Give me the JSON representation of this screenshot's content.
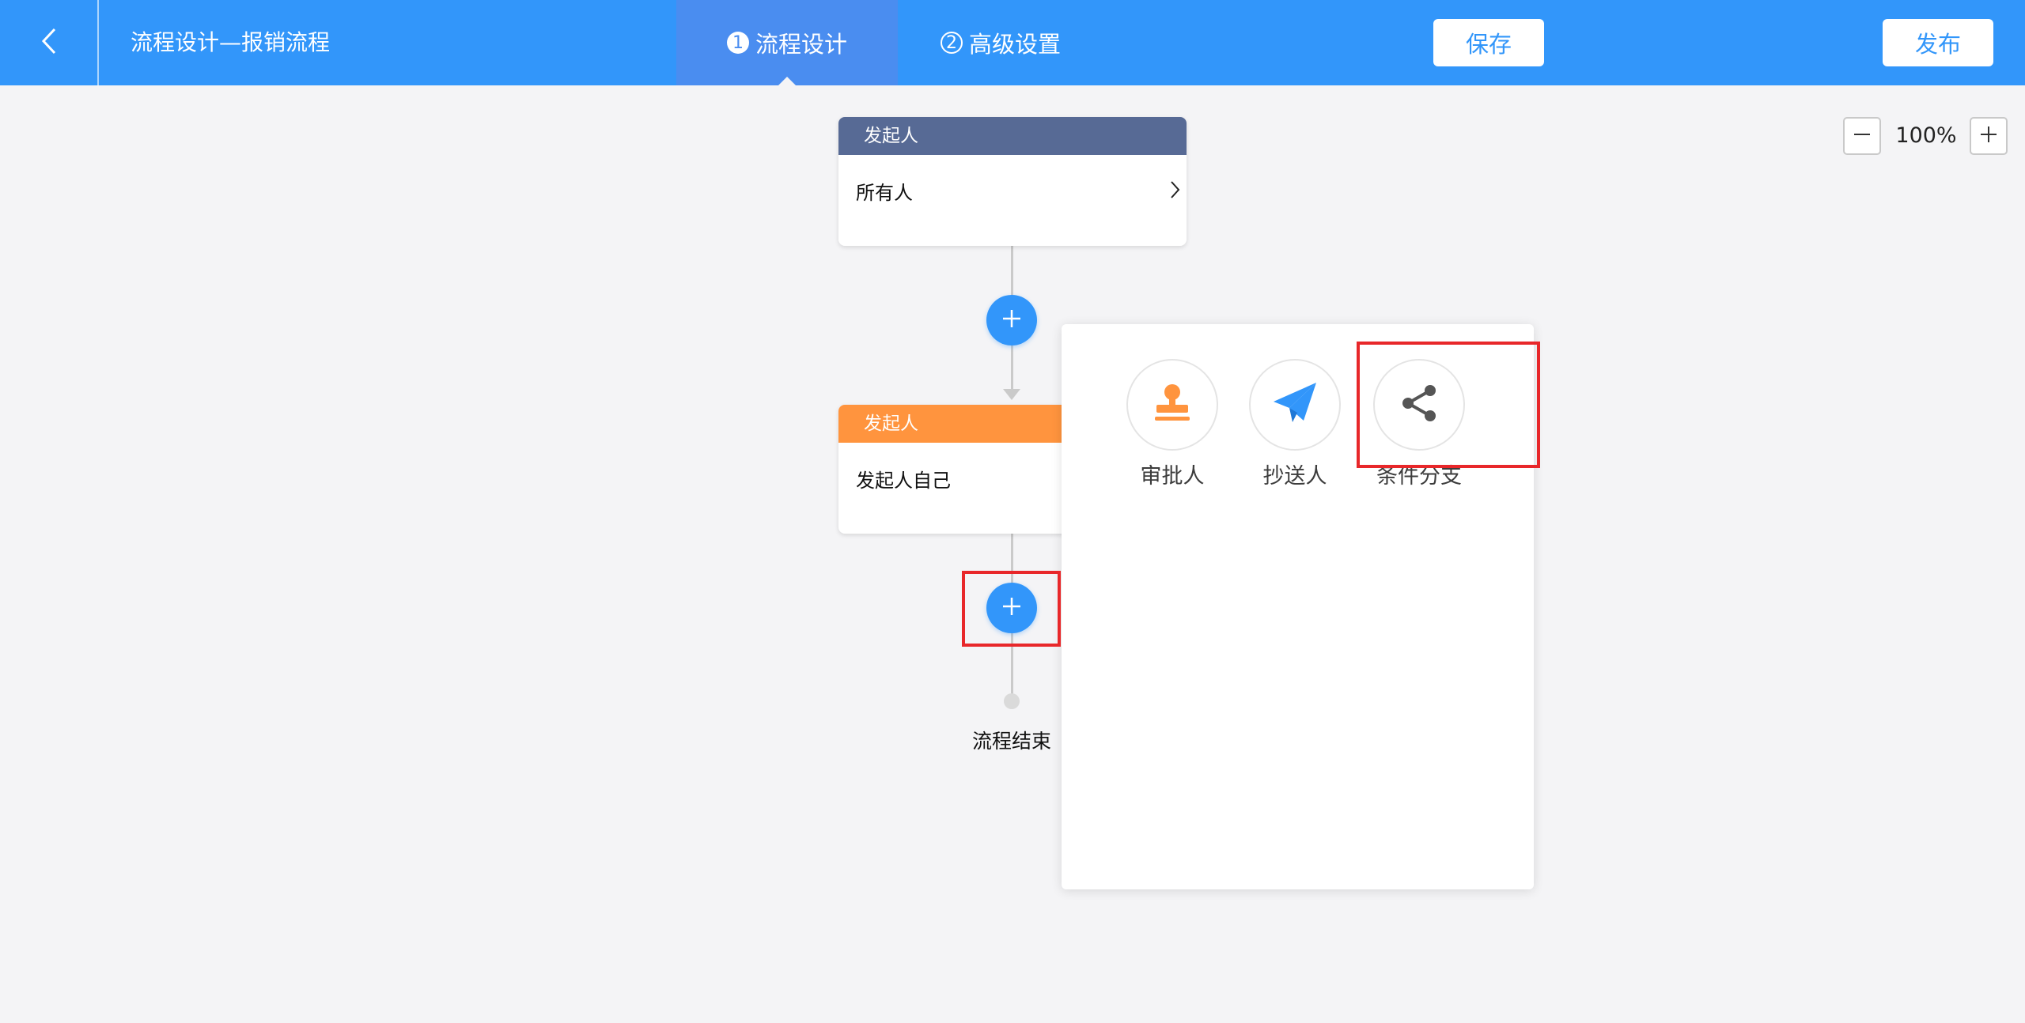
{
  "header": {
    "back_icon": "chevron-left-icon",
    "title": "流程设计—报销流程",
    "tabs": [
      {
        "number": "1",
        "label": "流程设计",
        "active": true
      },
      {
        "number": "2",
        "label": "高级设置",
        "active": false
      }
    ],
    "save_label": "保存",
    "publish_label": "发布",
    "background": "#3296fa"
  },
  "zoom": {
    "minus_icon": "minus-icon",
    "level": "100%",
    "plus_icon": "plus-icon"
  },
  "flow": {
    "nodes": [
      {
        "title": "发起人",
        "content": "所有人",
        "header_color": "#576a95"
      },
      {
        "title": "发起人",
        "content": "发起人自己",
        "header_color": "#ff943e"
      }
    ],
    "end_label": "流程结束"
  },
  "add_menu": {
    "items": [
      {
        "label": "审批人",
        "icon": "stamp-icon",
        "color": "#ff943e"
      },
      {
        "label": "抄送人",
        "icon": "paper-plane-icon",
        "color": "#3296fa"
      },
      {
        "label": "条件分支",
        "icon": "share-icon",
        "color": "#555555"
      }
    ]
  },
  "highlights": {
    "color": "#e8272a"
  }
}
